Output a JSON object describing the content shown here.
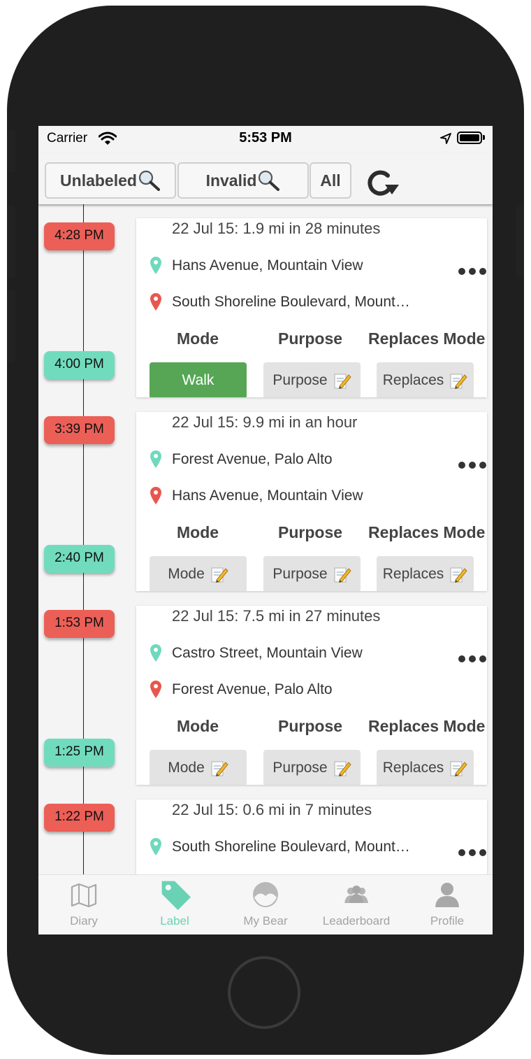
{
  "status_bar": {
    "carrier": "Carrier",
    "time": "5:53 PM"
  },
  "filters": {
    "unlabeled": "Unlabeled",
    "invalid": "Invalid",
    "all": "All"
  },
  "columns": {
    "mode": "Mode",
    "purpose": "Purpose",
    "replaces_mode": "Replaces Mode"
  },
  "trips": [
    {
      "title": "22 Jul 15: 1.9 mi in 28 minutes",
      "start_time": "4:28 PM",
      "end_time": "4:00 PM",
      "start": "Hans Avenue, Mountain View",
      "end": "South Shoreline Boulevard, Mount…",
      "mode": "Walk",
      "mode_selected": true,
      "purpose": "Purpose",
      "replaces": "Replaces"
    },
    {
      "title": "22 Jul 15: 9.9 mi in an hour",
      "start_time": "3:39 PM",
      "end_time": "2:40 PM",
      "start": "Forest Avenue, Palo Alto",
      "end": "Hans Avenue, Mountain View",
      "mode": "Mode",
      "mode_selected": false,
      "purpose": "Purpose",
      "replaces": "Replaces"
    },
    {
      "title": "22 Jul 15: 7.5 mi in 27 minutes",
      "start_time": "1:53 PM",
      "end_time": "1:25 PM",
      "start": "Castro Street, Mountain View",
      "end": "Forest Avenue, Palo Alto",
      "mode": "Mode",
      "mode_selected": false,
      "purpose": "Purpose",
      "replaces": "Replaces"
    },
    {
      "title": "22 Jul 15: 0.6 mi in 7 minutes",
      "start_time": "1:22 PM",
      "start": "South Shoreline Boulevard, Mount…"
    }
  ],
  "tabs": [
    {
      "label": "Diary",
      "icon": "map-icon"
    },
    {
      "label": "Label",
      "icon": "tag-icon",
      "active": true
    },
    {
      "label": "My Bear",
      "icon": "bear-icon"
    },
    {
      "label": "Leaderboard",
      "icon": "group-icon"
    },
    {
      "label": "Profile",
      "icon": "person-icon"
    }
  ],
  "colors": {
    "start_pin": "#6fd9bd",
    "end_pin": "#e8574f",
    "walk_button": "#56a655",
    "active_tab": "#69d2b4",
    "start_pill": "#ec5f57",
    "end_pill": "#71dcbd"
  }
}
